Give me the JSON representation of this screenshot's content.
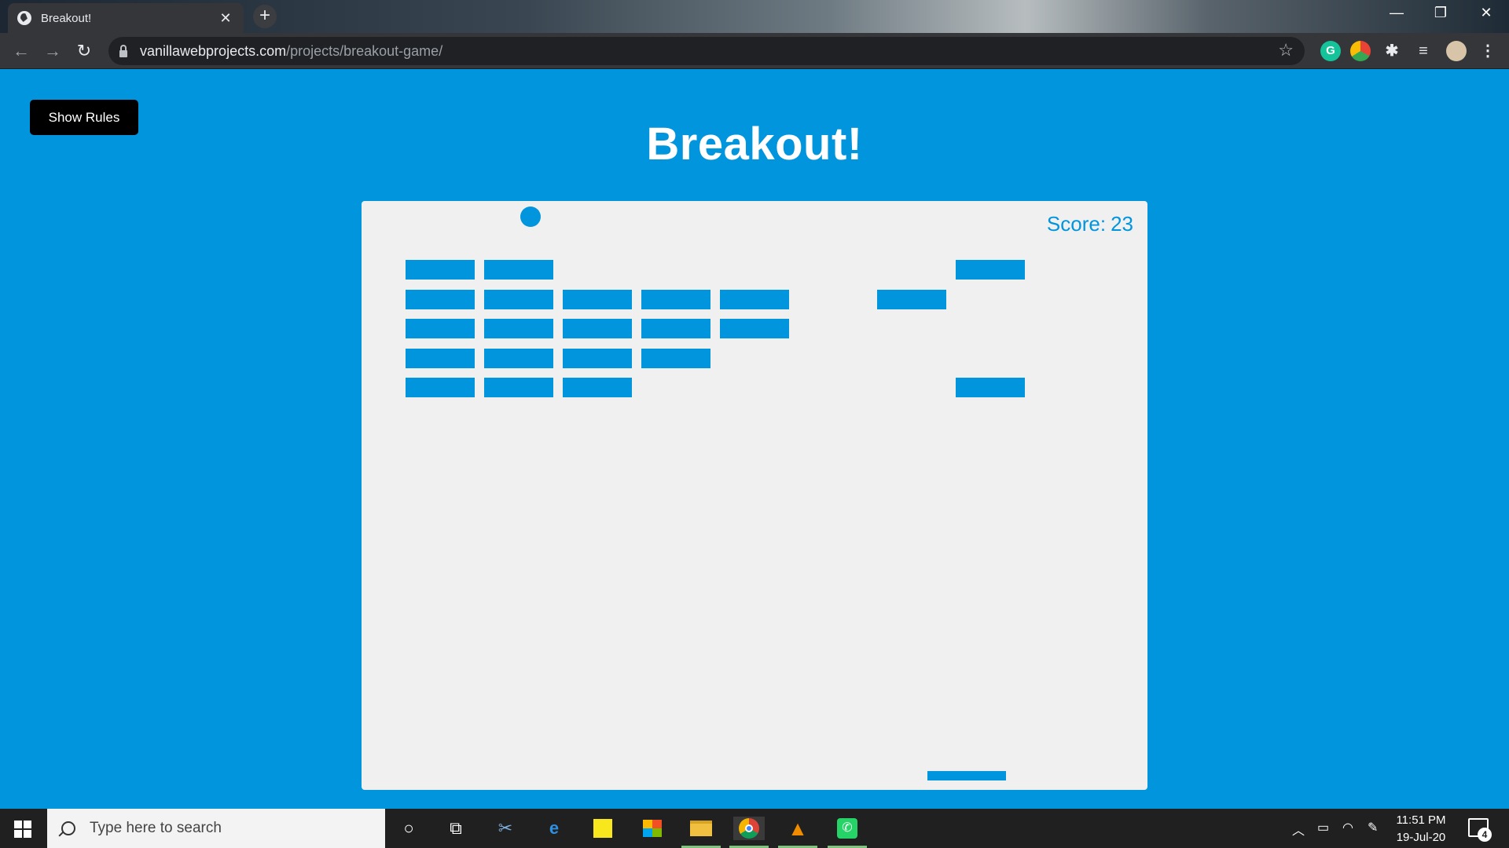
{
  "browser": {
    "tab_title": "Breakout!",
    "tab_close": "✕",
    "new_tab": "+",
    "url_host": "vanillawebprojects.com",
    "url_path": "/projects/breakout-game/",
    "star": "☆",
    "window_minimize": "—",
    "window_restore": "❐",
    "window_close": "✕"
  },
  "page": {
    "rules_button": "Show Rules",
    "title": "Breakout!"
  },
  "game": {
    "score_label": "Score:",
    "score": 23,
    "colors": {
      "bg": "#0095dd",
      "canvas": "#f0f0f0",
      "brick": "#0095dd"
    },
    "brick_grid": {
      "columns": 9,
      "rows": 5
    },
    "bricks_remaining": [
      {
        "col": 0,
        "row": 0
      },
      {
        "col": 0,
        "row": 1
      },
      {
        "col": 0,
        "row": 2
      },
      {
        "col": 0,
        "row": 3
      },
      {
        "col": 0,
        "row": 4
      },
      {
        "col": 1,
        "row": 0
      },
      {
        "col": 1,
        "row": 1
      },
      {
        "col": 1,
        "row": 2
      },
      {
        "col": 1,
        "row": 3
      },
      {
        "col": 1,
        "row": 4
      },
      {
        "col": 2,
        "row": 1
      },
      {
        "col": 2,
        "row": 2
      },
      {
        "col": 2,
        "row": 3
      },
      {
        "col": 2,
        "row": 4
      },
      {
        "col": 3,
        "row": 1
      },
      {
        "col": 3,
        "row": 2
      },
      {
        "col": 3,
        "row": 3
      },
      {
        "col": 4,
        "row": 1
      },
      {
        "col": 4,
        "row": 2
      },
      {
        "col": 6,
        "row": 1
      },
      {
        "col": 7,
        "row": 0
      },
      {
        "col": 7,
        "row": 4
      }
    ]
  },
  "taskbar": {
    "search_placeholder": "Type here to search",
    "time": "11:51 PM",
    "date": "19-Jul-20",
    "notification_count": "4"
  }
}
